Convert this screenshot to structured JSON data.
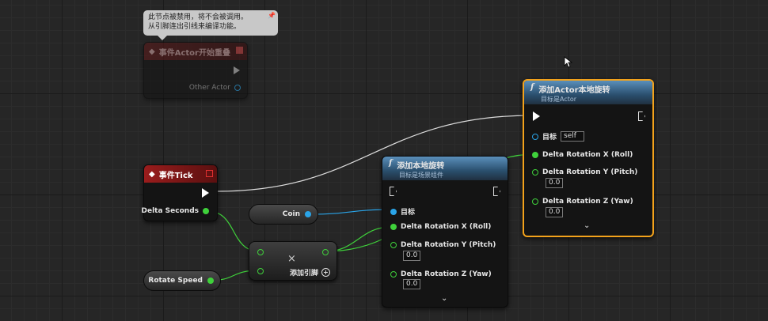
{
  "comment": {
    "line1": "此节点被禁用，将不会被调用。",
    "line2": "从引脚连出引线来编译功能。"
  },
  "disabled_event": {
    "title": "事件Actor开始重叠",
    "pin_other_actor": "Other Actor"
  },
  "event_tick": {
    "title": "事件Tick",
    "pin_delta_seconds": "Delta Seconds"
  },
  "coin_var": {
    "label": "Coin"
  },
  "rotate_speed_var": {
    "label": "Rotate Speed"
  },
  "multiply": {
    "symbol": "×",
    "add_pin_label": "添加引脚"
  },
  "add_local_rotation": {
    "icon": "f",
    "title": "添加本地旋转",
    "subtitle": "目标是场景组件",
    "pin_target": "目标",
    "pin_roll": "Delta Rotation X (Roll)",
    "pin_pitch": "Delta Rotation Y (Pitch)",
    "pitch_value": "0.0",
    "pin_yaw": "Delta Rotation Z (Yaw)",
    "yaw_value": "0.0"
  },
  "add_actor_local_rotation": {
    "icon": "f",
    "title": "添加Actor本地旋转",
    "subtitle": "目标是Actor",
    "pin_target": "目标",
    "target_value": "self",
    "pin_roll": "Delta Rotation X (Roll)",
    "pin_pitch": "Delta Rotation Y (Pitch)",
    "pitch_value": "0.0",
    "pin_yaw": "Delta Rotation Z (Yaw)",
    "yaw_value": "0.0"
  },
  "colors": {
    "float_pin": "#3fd13b",
    "object_pin": "#2aa4e8",
    "event_header": "#8a1818",
    "function_header": "#3a6f96",
    "selection": "#f3a21b"
  }
}
